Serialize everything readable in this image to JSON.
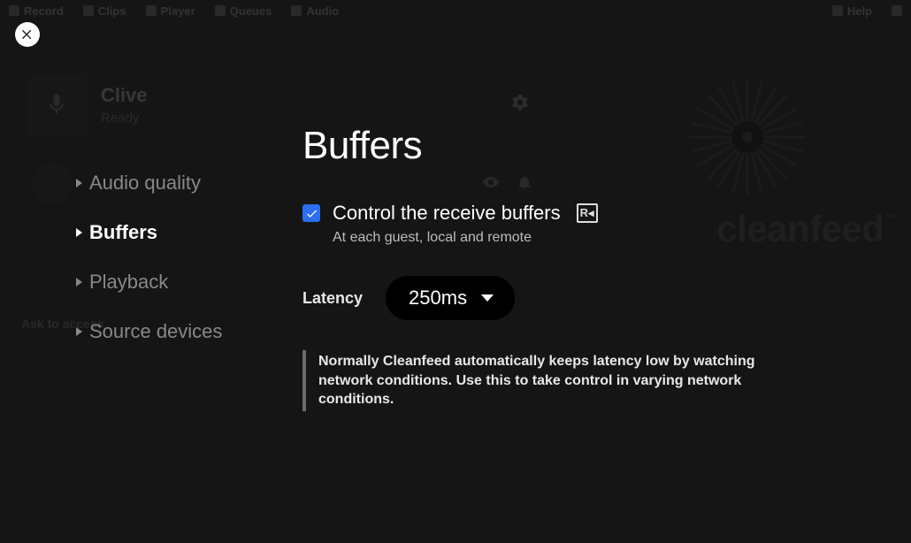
{
  "topbar": {
    "record": "Record",
    "clips": "Clips",
    "player": "Player",
    "queues": "Queues",
    "audio": "Audio",
    "help": "Help"
  },
  "participant": {
    "name": "Clive",
    "status": "Ready"
  },
  "ask_label": "Ask to access",
  "brand": {
    "name": "cleanfeed",
    "tm": "™"
  },
  "nav": {
    "audio_quality": "Audio quality",
    "buffers": "Buffers",
    "playback": "Playback",
    "source_devices": "Source devices"
  },
  "panel": {
    "title": "Buffers",
    "control_label": "Control the receive buffers",
    "rx_badge": "R◂",
    "control_sub": "At each guest, local and remote",
    "latency_label": "Latency",
    "latency_value": "250ms",
    "note": "Normally Cleanfeed automatically keeps latency low by watching network conditions. Use this to take control in varying network conditions."
  }
}
